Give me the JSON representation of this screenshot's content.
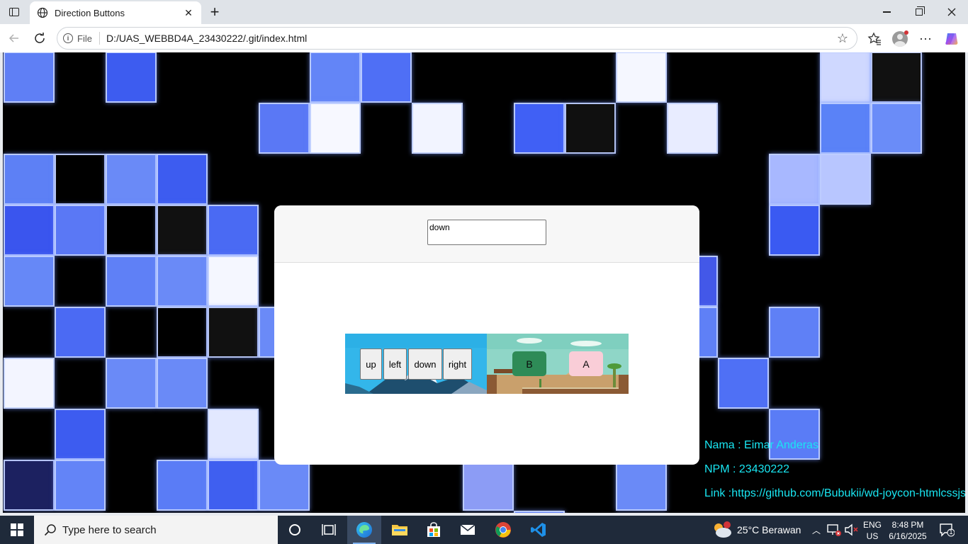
{
  "browser": {
    "tab_title": "Direction Buttons",
    "address_scheme": "File",
    "address_url": "D:/UAS_WEBBD4A_23430222/.git/index.html"
  },
  "page": {
    "output_value": "down",
    "dpad": {
      "up": "up",
      "left": "left",
      "down": "down",
      "right": "right"
    },
    "action_buttons": {
      "b": "B",
      "a": "A"
    },
    "info": {
      "name": "Nama : Eimar Anderas",
      "npm": "NPM : 23430222",
      "link": "Link :https://github.com/Bubukii/wd-joycon-htmlcssjs"
    },
    "colors": {
      "info_text": "#19e6f2",
      "button_b": "#2e8b57",
      "button_a": "#f9cdd7",
      "background": "#000000"
    }
  },
  "taskbar": {
    "search_placeholder": "Type here to search",
    "weather": "25°C  Berawan",
    "lang_1": "ENG",
    "lang_2": "US",
    "time": "8:48 PM",
    "date": "6/16/2025",
    "notification_count": "1",
    "apps": [
      "task-view",
      "edge",
      "file-explorer",
      "microsoft-store",
      "mail",
      "chrome",
      "vscode"
    ]
  }
}
